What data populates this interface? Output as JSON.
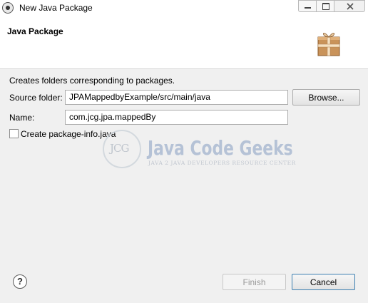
{
  "window": {
    "title": "New Java Package",
    "title_icon": "eclipse-icon"
  },
  "header": {
    "title": "Java Package",
    "icon": "package-icon"
  },
  "form": {
    "description": "Creates folders corresponding to packages.",
    "source_folder_label": "Source folder:",
    "source_folder_value": "JPAMappedbyExample/src/main/java",
    "browse_label": "Browse...",
    "name_label": "Name:",
    "name_value": "com.jcg.jpa.mappedBy",
    "package_info_label": "Create package-info.java",
    "package_info_checked": false
  },
  "watermark": {
    "logo_text": "JCG",
    "title": "Java Code Geeks",
    "subtitle": "JAVA 2 JAVA DEVELOPERS RESOURCE CENTER"
  },
  "footer": {
    "help_icon": "help-icon",
    "help_glyph": "?",
    "finish_label": "Finish",
    "cancel_label": "Cancel"
  }
}
